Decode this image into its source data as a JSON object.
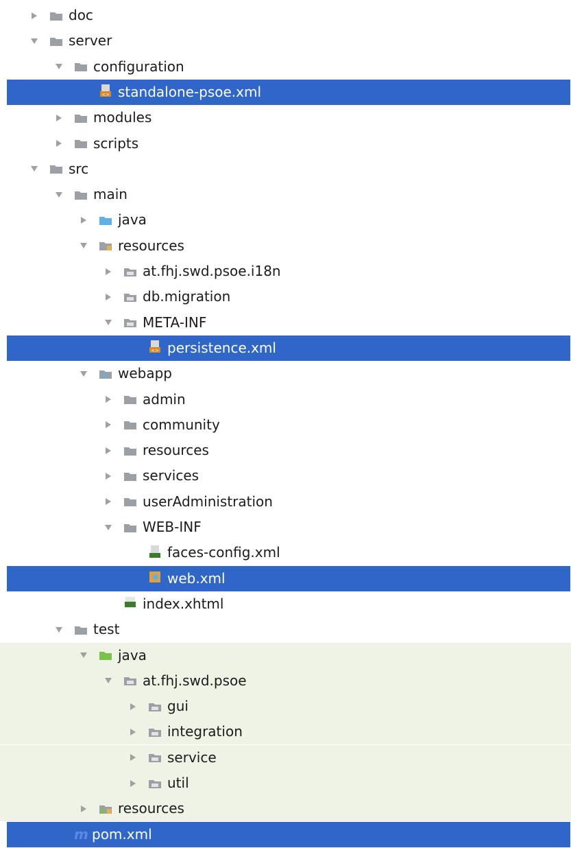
{
  "rows": [
    {
      "label": "doc",
      "depth": 0,
      "arrow": "right",
      "icon": "folder-icon",
      "highlight": false,
      "band": false
    },
    {
      "label": "server",
      "depth": 0,
      "arrow": "down",
      "icon": "folder-icon",
      "highlight": false,
      "band": false
    },
    {
      "label": "configuration",
      "depth": 1,
      "arrow": "down",
      "icon": "folder-icon",
      "highlight": false,
      "band": false
    },
    {
      "label": "standalone-psoe.xml",
      "depth": 2,
      "arrow": "none",
      "icon": "xml-file-icon",
      "highlight": true,
      "band": false
    },
    {
      "label": "modules",
      "depth": 1,
      "arrow": "right",
      "icon": "folder-icon",
      "highlight": false,
      "band": false
    },
    {
      "label": "scripts",
      "depth": 1,
      "arrow": "right",
      "icon": "folder-icon",
      "highlight": false,
      "band": false
    },
    {
      "label": "src",
      "depth": 0,
      "arrow": "down",
      "icon": "folder-icon",
      "highlight": false,
      "band": false
    },
    {
      "label": "main",
      "depth": 1,
      "arrow": "down",
      "icon": "folder-icon",
      "highlight": false,
      "band": false
    },
    {
      "label": "java",
      "depth": 2,
      "arrow": "right",
      "icon": "source-folder-icon",
      "highlight": false,
      "band": false
    },
    {
      "label": "resources",
      "depth": 2,
      "arrow": "down",
      "icon": "resources-folder-icon",
      "highlight": false,
      "band": false
    },
    {
      "label": "at.fhj.swd.psoe.i18n",
      "depth": 3,
      "arrow": "right",
      "icon": "package-icon",
      "highlight": false,
      "band": false
    },
    {
      "label": "db.migration",
      "depth": 3,
      "arrow": "right",
      "icon": "package-icon",
      "highlight": false,
      "band": false
    },
    {
      "label": "META-INF",
      "depth": 3,
      "arrow": "down",
      "icon": "package-icon",
      "highlight": false,
      "band": false
    },
    {
      "label": "persistence.xml",
      "depth": 4,
      "arrow": "none",
      "icon": "xml-file-icon",
      "highlight": true,
      "band": false
    },
    {
      "label": "webapp",
      "depth": 2,
      "arrow": "down",
      "icon": "web-folder-icon",
      "highlight": false,
      "band": false
    },
    {
      "label": "admin",
      "depth": 3,
      "arrow": "right",
      "icon": "folder-icon",
      "highlight": false,
      "band": false
    },
    {
      "label": "community",
      "depth": 3,
      "arrow": "right",
      "icon": "folder-icon",
      "highlight": false,
      "band": false
    },
    {
      "label": "resources",
      "depth": 3,
      "arrow": "right",
      "icon": "folder-icon",
      "highlight": false,
      "band": false
    },
    {
      "label": "services",
      "depth": 3,
      "arrow": "right",
      "icon": "folder-icon",
      "highlight": false,
      "band": false
    },
    {
      "label": "userAdministration",
      "depth": 3,
      "arrow": "right",
      "icon": "folder-icon",
      "highlight": false,
      "band": false
    },
    {
      "label": "WEB-INF",
      "depth": 3,
      "arrow": "down",
      "icon": "folder-icon",
      "highlight": false,
      "band": false
    },
    {
      "label": "faces-config.xml",
      "depth": 4,
      "arrow": "none",
      "icon": "jsf-xml-file-icon",
      "highlight": false,
      "band": false
    },
    {
      "label": "web.xml",
      "depth": 4,
      "arrow": "none",
      "icon": "web-xml-file-icon",
      "highlight": true,
      "band": false
    },
    {
      "label": "index.xhtml",
      "depth": 3,
      "arrow": "none",
      "icon": "xhtml-file-icon",
      "highlight": false,
      "band": false
    },
    {
      "label": "test",
      "depth": 1,
      "arrow": "down",
      "icon": "folder-icon",
      "highlight": false,
      "band": false
    },
    {
      "label": "java",
      "depth": 2,
      "arrow": "down",
      "icon": "test-source-folder-icon",
      "highlight": false,
      "band": true
    },
    {
      "label": "at.fhj.swd.psoe",
      "depth": 3,
      "arrow": "down",
      "icon": "package-icon",
      "highlight": false,
      "band": true
    },
    {
      "label": "gui",
      "depth": 4,
      "arrow": "right",
      "icon": "package-icon",
      "highlight": false,
      "band": true
    },
    {
      "label": "integration",
      "depth": 4,
      "arrow": "right",
      "icon": "package-icon",
      "highlight": false,
      "band": true
    },
    {
      "label": "service",
      "depth": 4,
      "arrow": "right",
      "icon": "package-icon",
      "highlight": false,
      "band": true
    },
    {
      "label": "util",
      "depth": 4,
      "arrow": "right",
      "icon": "package-icon",
      "highlight": false,
      "band": true
    },
    {
      "label": "resources",
      "depth": 2,
      "arrow": "right",
      "icon": "test-resources-folder-icon",
      "highlight": false,
      "band": true
    },
    {
      "label": "pom.xml",
      "depth": 1,
      "arrow": "none",
      "icon": "maven-icon",
      "highlight": true,
      "band": false
    }
  ],
  "colors": {
    "selection": "#2f66c8",
    "test_band": "#eef3e6",
    "folder": "#9aa0a6",
    "source_folder": "#5fb0e6",
    "test_folder": "#79c34a",
    "arrow": "#a0a0a0"
  }
}
